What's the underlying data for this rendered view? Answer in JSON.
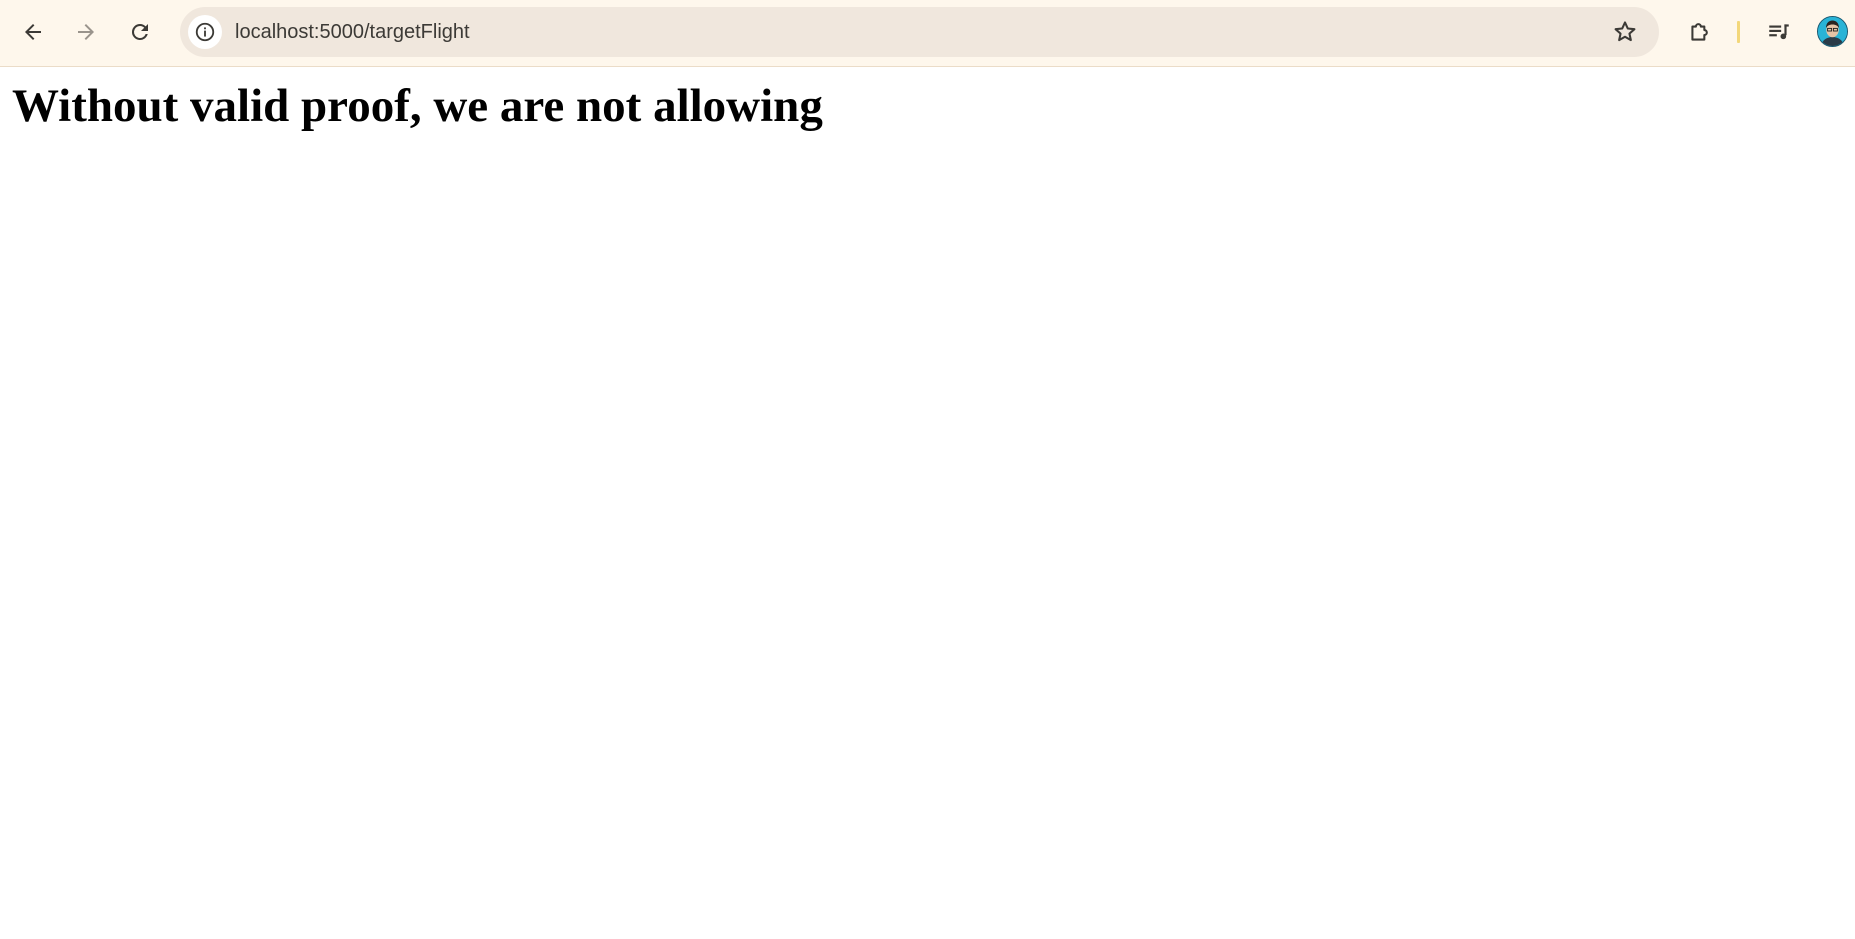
{
  "browser": {
    "address_bar": {
      "url": "localhost:5000/targetFlight"
    },
    "icons": {
      "back": "arrow-left-icon",
      "forward": "arrow-right-icon",
      "reload": "reload-icon",
      "site_info": "info-icon",
      "bookmark": "star-icon",
      "extensions": "puzzle-icon",
      "media": "playlist-music-icon",
      "profile": "avatar"
    },
    "colors": {
      "toolbar_bg": "#fef7ec",
      "omnibox_bg": "#f0e7dd",
      "divider_accent": "#f3d77a"
    }
  },
  "page": {
    "heading": "Without valid proof, we are not allowing"
  }
}
